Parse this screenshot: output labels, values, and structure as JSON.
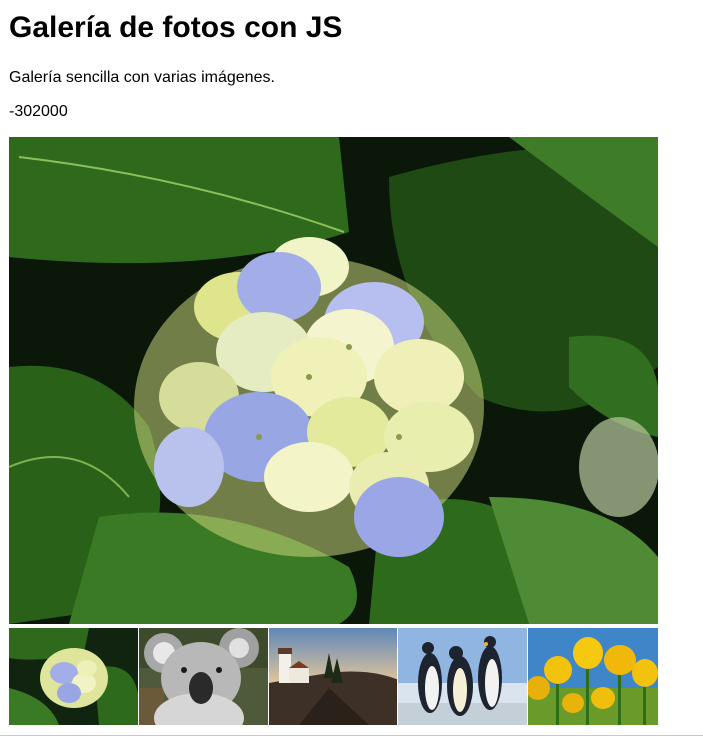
{
  "page": {
    "title": "Galería de fotos con JS",
    "description": "Galería sencilla con varias imágenes.",
    "counter": "-302000"
  },
  "gallery": {
    "main_image": {
      "subject": "hydrangea-flower"
    },
    "thumbnails": [
      {
        "subject": "hydrangea-flower"
      },
      {
        "subject": "koala"
      },
      {
        "subject": "lighthouse"
      },
      {
        "subject": "penguins"
      },
      {
        "subject": "tulips"
      }
    ]
  },
  "colors": {
    "leaf_dark": "#1f4a14",
    "leaf_light": "#4f8a34",
    "petal_blue": "#9aa6e6",
    "petal_cream": "#eef0b8",
    "sky": "#8fb5e0",
    "tulip": "#f2c20c"
  }
}
